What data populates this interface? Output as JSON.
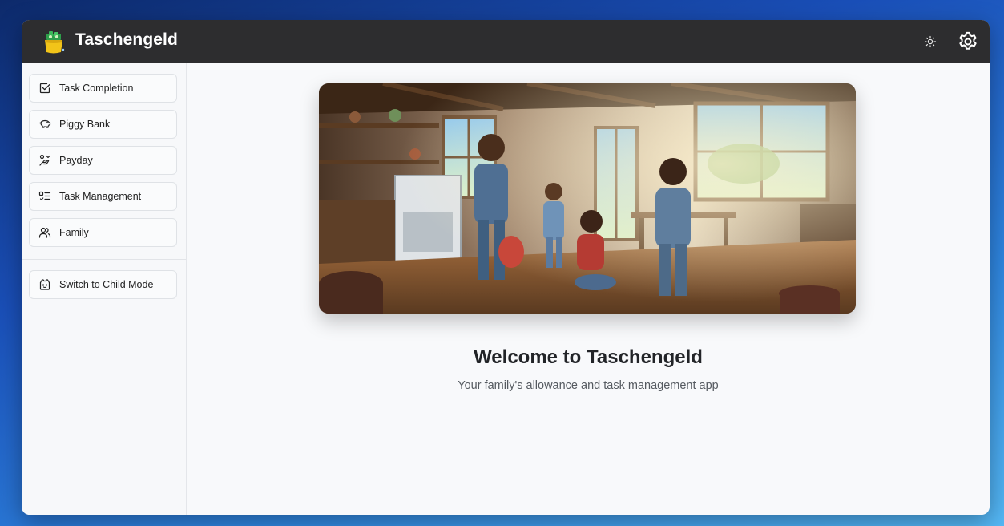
{
  "app": {
    "title": "Taschengeld"
  },
  "header": {
    "theme_icon": "sun-icon",
    "settings_icon": "gear-icon"
  },
  "sidebar": {
    "items": [
      {
        "label": "Task Completion",
        "icon": "checkbox-icon"
      },
      {
        "label": "Piggy Bank",
        "icon": "piggy-bank-icon"
      },
      {
        "label": "Payday",
        "icon": "hand-coins-icon"
      },
      {
        "label": "Task Management",
        "icon": "list-todo-icon"
      },
      {
        "label": "Family",
        "icon": "users-icon"
      }
    ],
    "switch_mode": {
      "label": "Switch to Child Mode",
      "icon": "baby-face-icon"
    }
  },
  "main": {
    "welcome": "Welcome to Taschengeld",
    "tagline": "Your family's allowance and task management app"
  },
  "colors": {
    "topbar": "#2d2d2f",
    "background": "#f8f9fb",
    "text_primary": "#222428",
    "text_secondary": "#555a60"
  }
}
